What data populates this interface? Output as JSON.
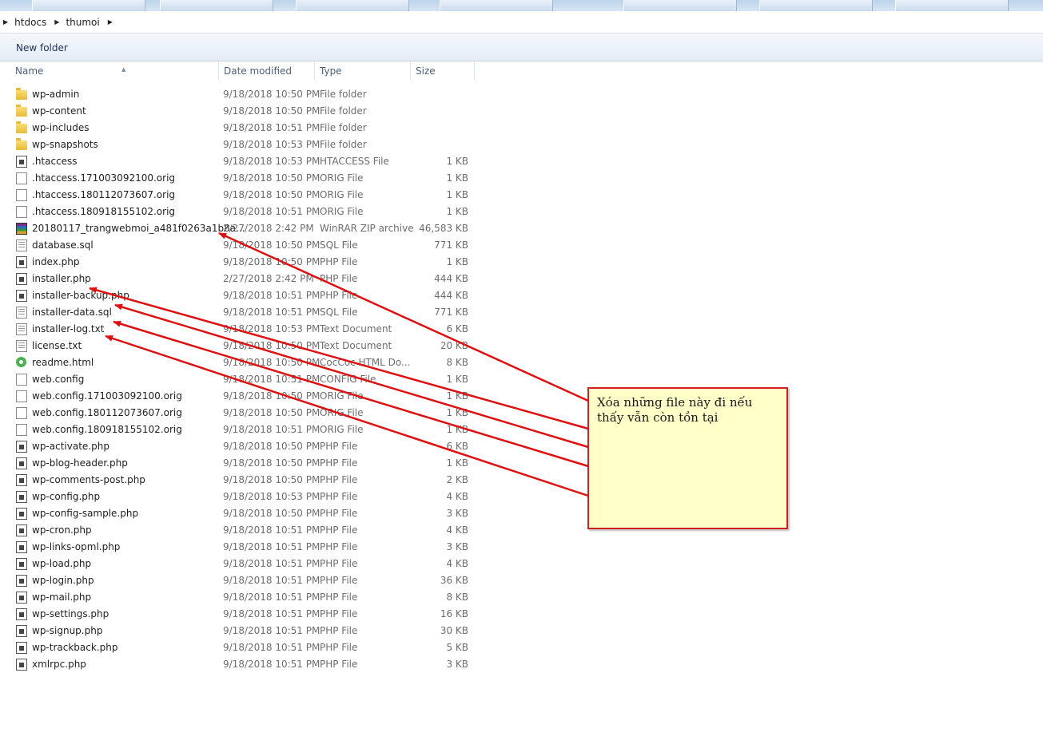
{
  "breadcrumb": {
    "items": [
      "htdocs",
      "thumoi"
    ]
  },
  "toolbar": {
    "new_folder_label": "New folder"
  },
  "columns": {
    "name": "Name",
    "date": "Date modified",
    "type": "Type",
    "size": "Size"
  },
  "files": [
    {
      "name": "wp-admin",
      "date": "9/18/2018 10:50 PM",
      "type": "File folder",
      "size": "",
      "icon": "folder-icon"
    },
    {
      "name": "wp-content",
      "date": "9/18/2018 10:50 PM",
      "type": "File folder",
      "size": "",
      "icon": "folder-icon"
    },
    {
      "name": "wp-includes",
      "date": "9/18/2018 10:51 PM",
      "type": "File folder",
      "size": "",
      "icon": "folder-icon"
    },
    {
      "name": "wp-snapshots",
      "date": "9/18/2018 10:53 PM",
      "type": "File folder",
      "size": "",
      "icon": "folder-icon"
    },
    {
      "name": ".htaccess",
      "date": "9/18/2018 10:53 PM",
      "type": "HTACCESS File",
      "size": "1 KB",
      "icon": "system-file-icon"
    },
    {
      "name": ".htaccess.171003092100.orig",
      "date": "9/18/2018 10:50 PM",
      "type": "ORIG File",
      "size": "1 KB",
      "icon": "blank-file-icon"
    },
    {
      "name": ".htaccess.180112073607.orig",
      "date": "9/18/2018 10:50 PM",
      "type": "ORIG File",
      "size": "1 KB",
      "icon": "blank-file-icon"
    },
    {
      "name": ".htaccess.180918155102.orig",
      "date": "9/18/2018 10:51 PM",
      "type": "ORIG File",
      "size": "1 KB",
      "icon": "blank-file-icon"
    },
    {
      "name": "20180117_trangwebmoi_a481f0263a1b8a...",
      "date": "2/27/2018 2:42 PM",
      "type": "WinRAR ZIP archive",
      "size": "46,583 KB",
      "icon": "winrar-archive-icon"
    },
    {
      "name": "database.sql",
      "date": "9/18/2018 10:50 PM",
      "type": "SQL File",
      "size": "771 KB",
      "icon": "text-file-icon"
    },
    {
      "name": "index.php",
      "date": "9/18/2018 10:50 PM",
      "type": "PHP File",
      "size": "1 KB",
      "icon": "php-file-icon"
    },
    {
      "name": "installer.php",
      "date": "2/27/2018 2:42 PM",
      "type": "PHP File",
      "size": "444 KB",
      "icon": "php-file-icon"
    },
    {
      "name": "installer-backup.php",
      "date": "9/18/2018 10:51 PM",
      "type": "PHP File",
      "size": "444 KB",
      "icon": "php-file-icon"
    },
    {
      "name": "installer-data.sql",
      "date": "9/18/2018 10:51 PM",
      "type": "SQL File",
      "size": "771 KB",
      "icon": "text-file-icon"
    },
    {
      "name": "installer-log.txt",
      "date": "9/18/2018 10:53 PM",
      "type": "Text Document",
      "size": "6 KB",
      "icon": "text-file-icon"
    },
    {
      "name": "license.txt",
      "date": "9/18/2018 10:50 PM",
      "type": "Text Document",
      "size": "20 KB",
      "icon": "text-file-icon"
    },
    {
      "name": "readme.html",
      "date": "9/18/2018 10:50 PM",
      "type": "CocCoc HTML Do...",
      "size": "8 KB",
      "icon": "coccoc-html-icon"
    },
    {
      "name": "web.config",
      "date": "9/18/2018 10:51 PM",
      "type": "CONFIG File",
      "size": "1 KB",
      "icon": "blank-file-icon"
    },
    {
      "name": "web.config.171003092100.orig",
      "date": "9/18/2018 10:50 PM",
      "type": "ORIG File",
      "size": "1 KB",
      "icon": "blank-file-icon"
    },
    {
      "name": "web.config.180112073607.orig",
      "date": "9/18/2018 10:50 PM",
      "type": "ORIG File",
      "size": "1 KB",
      "icon": "blank-file-icon"
    },
    {
      "name": "web.config.180918155102.orig",
      "date": "9/18/2018 10:51 PM",
      "type": "ORIG File",
      "size": "1 KB",
      "icon": "blank-file-icon"
    },
    {
      "name": "wp-activate.php",
      "date": "9/18/2018 10:50 PM",
      "type": "PHP File",
      "size": "6 KB",
      "icon": "php-file-icon"
    },
    {
      "name": "wp-blog-header.php",
      "date": "9/18/2018 10:50 PM",
      "type": "PHP File",
      "size": "1 KB",
      "icon": "php-file-icon"
    },
    {
      "name": "wp-comments-post.php",
      "date": "9/18/2018 10:50 PM",
      "type": "PHP File",
      "size": "2 KB",
      "icon": "php-file-icon"
    },
    {
      "name": "wp-config.php",
      "date": "9/18/2018 10:53 PM",
      "type": "PHP File",
      "size": "4 KB",
      "icon": "php-file-icon"
    },
    {
      "name": "wp-config-sample.php",
      "date": "9/18/2018 10:50 PM",
      "type": "PHP File",
      "size": "3 KB",
      "icon": "php-file-icon"
    },
    {
      "name": "wp-cron.php",
      "date": "9/18/2018 10:51 PM",
      "type": "PHP File",
      "size": "4 KB",
      "icon": "php-file-icon"
    },
    {
      "name": "wp-links-opml.php",
      "date": "9/18/2018 10:51 PM",
      "type": "PHP File",
      "size": "3 KB",
      "icon": "php-file-icon"
    },
    {
      "name": "wp-load.php",
      "date": "9/18/2018 10:51 PM",
      "type": "PHP File",
      "size": "4 KB",
      "icon": "php-file-icon"
    },
    {
      "name": "wp-login.php",
      "date": "9/18/2018 10:51 PM",
      "type": "PHP File",
      "size": "36 KB",
      "icon": "php-file-icon"
    },
    {
      "name": "wp-mail.php",
      "date": "9/18/2018 10:51 PM",
      "type": "PHP File",
      "size": "8 KB",
      "icon": "php-file-icon"
    },
    {
      "name": "wp-settings.php",
      "date": "9/18/2018 10:51 PM",
      "type": "PHP File",
      "size": "16 KB",
      "icon": "php-file-icon"
    },
    {
      "name": "wp-signup.php",
      "date": "9/18/2018 10:51 PM",
      "type": "PHP File",
      "size": "30 KB",
      "icon": "php-file-icon"
    },
    {
      "name": "wp-trackback.php",
      "date": "9/18/2018 10:51 PM",
      "type": "PHP File",
      "size": "5 KB",
      "icon": "php-file-icon"
    },
    {
      "name": "xmlrpc.php",
      "date": "9/18/2018 10:51 PM",
      "type": "PHP File",
      "size": "3 KB",
      "icon": "php-file-icon"
    }
  ],
  "annotation": {
    "text": "Xóa những file này đi nếu thấy vẫn còn tồn tại",
    "border_color": "#d02020",
    "background_color": "#ffffc8",
    "arrow_color": "#dd1111"
  }
}
